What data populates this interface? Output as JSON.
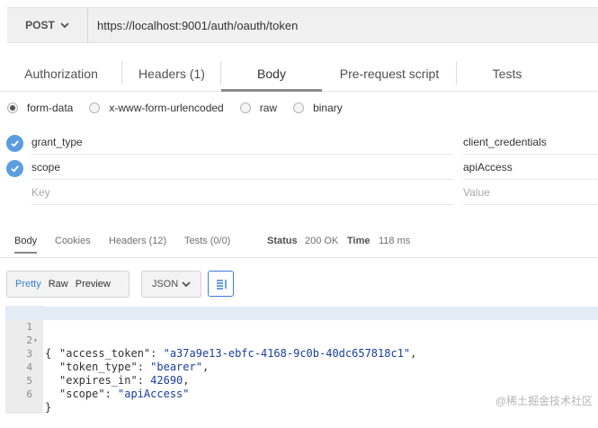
{
  "request": {
    "method": "POST",
    "url": "https://localhost:9001/auth/oauth/token"
  },
  "request_tabs": [
    "Authorization",
    "Headers (1)",
    "Body",
    "Pre-request script",
    "Tests"
  ],
  "body_types": [
    "form-data",
    "x-www-form-urlencoded",
    "raw",
    "binary"
  ],
  "form_rows": [
    {
      "key": "grant_type",
      "value": "client_credentials"
    },
    {
      "key": "scope",
      "value": "apiAccess"
    }
  ],
  "form_placeholders": {
    "key": "Key",
    "value": "Value"
  },
  "response_tabs": [
    "Body",
    "Cookies",
    "Headers (12)",
    "Tests (0/0)"
  ],
  "response_meta": {
    "status_label": "Status",
    "status_value": "200 OK",
    "time_label": "Time",
    "time_value": "118 ms"
  },
  "view_modes": [
    "Pretty",
    "Raw",
    "Preview"
  ],
  "format": "JSON",
  "code": {
    "line_numbers": [
      "1",
      "2",
      "3",
      "4",
      "5",
      "6"
    ],
    "open_brace": "{",
    "close_brace": "}",
    "entries": [
      {
        "key": "\"access_token\"",
        "value": "\"a37a9e13-ebfc-4168-9c0b-40dc657818c1\"",
        "sep": ","
      },
      {
        "key": "\"token_type\"",
        "value": "\"bearer\"",
        "sep": ","
      },
      {
        "key": "\"expires_in\"",
        "value": "42690",
        "sep": ","
      },
      {
        "key": "\"scope\"",
        "value": "\"apiAccess\"",
        "sep": ""
      }
    ]
  },
  "watermark": "@稀土掘金技术社区",
  "colors": {
    "accent": "#3b7ed6",
    "check": "#5c9de0"
  }
}
